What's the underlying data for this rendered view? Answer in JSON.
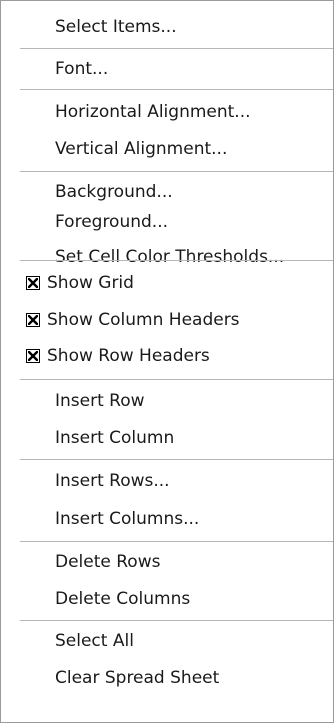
{
  "menu": {
    "items": [
      {
        "label": "Select Items..."
      },
      {
        "label": "Font..."
      },
      {
        "label": "Horizontal Alignment..."
      },
      {
        "label": "Vertical Alignment..."
      },
      {
        "label": "Background..."
      },
      {
        "label": "Foreground..."
      },
      {
        "label": "Set Cell Color Thresholds..."
      },
      {
        "label": "Show Grid",
        "checked": true
      },
      {
        "label": "Show Column Headers",
        "checked": true
      },
      {
        "label": "Show Row Headers",
        "checked": true
      },
      {
        "label": "Insert Row"
      },
      {
        "label": "Insert Column"
      },
      {
        "label": "Insert Rows..."
      },
      {
        "label": "Insert Columns..."
      },
      {
        "label": "Delete Rows"
      },
      {
        "label": "Delete Columns"
      },
      {
        "label": "Select All"
      },
      {
        "label": "Clear Spread Sheet"
      }
    ]
  }
}
